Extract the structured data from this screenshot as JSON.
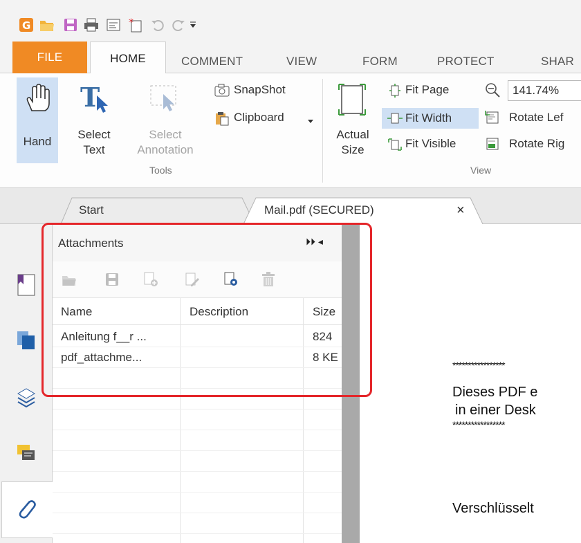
{
  "qat": {
    "icons": [
      "app-icon",
      "open-folder-icon",
      "save-icon",
      "print-icon",
      "properties-icon",
      "new-icon",
      "undo-icon",
      "redo-icon",
      "customize-dropdown-icon"
    ]
  },
  "ribbon_tabs": [
    "FILE",
    "HOME",
    "COMMENT",
    "VIEW",
    "FORM",
    "PROTECT",
    "SHAR"
  ],
  "ribbon": {
    "hand": "Hand",
    "select_text_1": "Select",
    "select_text_2": "Text",
    "select_annotation_1": "Select",
    "select_annotation_2": "Annotation",
    "snapshot": "SnapShot",
    "clipboard": "Clipboard",
    "tools_group": "Tools",
    "actual_size_1": "Actual",
    "actual_size_2": "Size",
    "fit_page": "Fit Page",
    "fit_width": "Fit Width",
    "fit_visible": "Fit Visible",
    "zoom_value": "141.74%",
    "rotate_left": "Rotate Lef",
    "rotate_right": "Rotate Rig",
    "view_group": "View"
  },
  "doc_tabs": {
    "start": "Start",
    "mail": "Mail.pdf (SECURED)",
    "close": "×"
  },
  "panel": {
    "title": "Attachments",
    "header_controls": "⏵⏵ ◂",
    "columns": [
      "Name",
      "Description",
      "Size"
    ],
    "rows": [
      {
        "name": "Anleitung f__r ...",
        "description": "",
        "size": "824"
      },
      {
        "name": "pdf_attachme...",
        "description": "",
        "size": "8 KE"
      }
    ]
  },
  "document": {
    "stars_1": "*****************",
    "line_1": "Dieses PDF e",
    "line_2": "in einer Desk",
    "stars_2": "*****************",
    "line_3": "Verschlüsselt"
  },
  "colors": {
    "accent": "#f08a24",
    "highlight": "#e4262a",
    "selection": "#cfe0f4"
  }
}
